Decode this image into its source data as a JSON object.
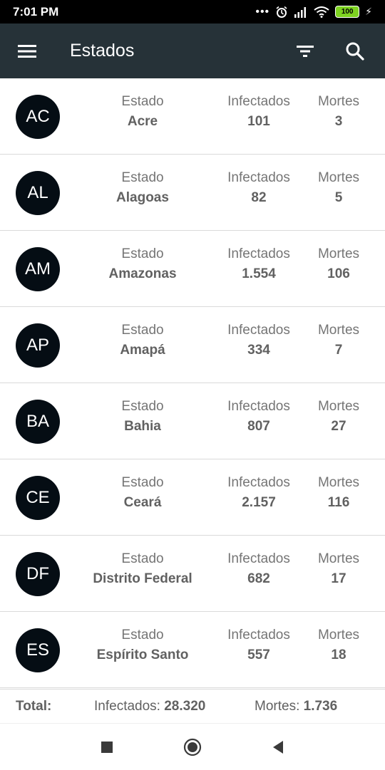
{
  "status_bar": {
    "time": "7:01 PM",
    "battery": "100"
  },
  "app_bar": {
    "title": "Estados"
  },
  "labels": {
    "estado": "Estado",
    "infectados": "Infectados",
    "mortes": "Mortes"
  },
  "states": [
    {
      "abbr": "AC",
      "name": "Acre",
      "infected": "101",
      "deaths": "3"
    },
    {
      "abbr": "AL",
      "name": "Alagoas",
      "infected": "82",
      "deaths": "5"
    },
    {
      "abbr": "AM",
      "name": "Amazonas",
      "infected": "1.554",
      "deaths": "106"
    },
    {
      "abbr": "AP",
      "name": "Amapá",
      "infected": "334",
      "deaths": "7"
    },
    {
      "abbr": "BA",
      "name": "Bahia",
      "infected": "807",
      "deaths": "27"
    },
    {
      "abbr": "CE",
      "name": "Ceará",
      "infected": "2.157",
      "deaths": "116"
    },
    {
      "abbr": "DF",
      "name": "Distrito Federal",
      "infected": "682",
      "deaths": "17"
    },
    {
      "abbr": "ES",
      "name": "Espírito Santo",
      "infected": "557",
      "deaths": "18"
    }
  ],
  "totals": {
    "label": "Total:",
    "infected_label": "Infectados:",
    "infected_value": "28.320",
    "deaths_label": "Mortes:",
    "deaths_value": "1.736"
  },
  "colors": {
    "app_bar": "#263238",
    "avatar": "#050d14"
  }
}
